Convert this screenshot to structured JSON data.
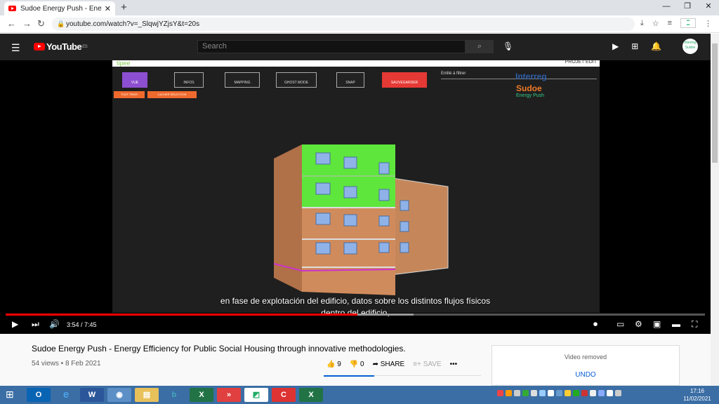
{
  "browser": {
    "tab_title": "Sudoe Energy Push - Energy Effic",
    "url": "youtube.com/watch?v=_SlqwjYZjsY&t=20s"
  },
  "youtube": {
    "logo_text": "YouTube",
    "region": "ES",
    "search_placeholder": "Search"
  },
  "video_content": {
    "app_name": "tipee",
    "top_right_label": "PROJET EDIT",
    "buttons": [
      "VUE",
      "INFOS",
      "MAPPING",
      "GHOST MODE",
      "SNAP",
      "SAUVEGARDER"
    ],
    "small_buttons": [
      "TOUT TRIER",
      "CACHER SÉLECTION"
    ],
    "filter_label": "Entité à filtrer",
    "logo_interreg": "Interreg",
    "logo_sudoe": "Sudoe",
    "logo_energy": "Energy Push"
  },
  "subtitles": {
    "line1": "en fase de explotación del edificio, datos sobre los distintos flujos físicos",
    "line2": "dentro del edificio,"
  },
  "player": {
    "time": "3:54 / 7:45",
    "progress_fraction": 0.503
  },
  "video_info": {
    "title": "Sudoe Energy Push - Energy Efficiency for Public Social Housing through innovative methodologies.",
    "meta": "54 views • 8 Feb 2021",
    "likes": "9",
    "dislikes": "0",
    "share": "SHARE",
    "save": "SAVE"
  },
  "removed_card": {
    "text": "Video removed",
    "undo": "UNDO"
  },
  "taskbar": {
    "time": "17:16",
    "date": "11/02/2021"
  }
}
